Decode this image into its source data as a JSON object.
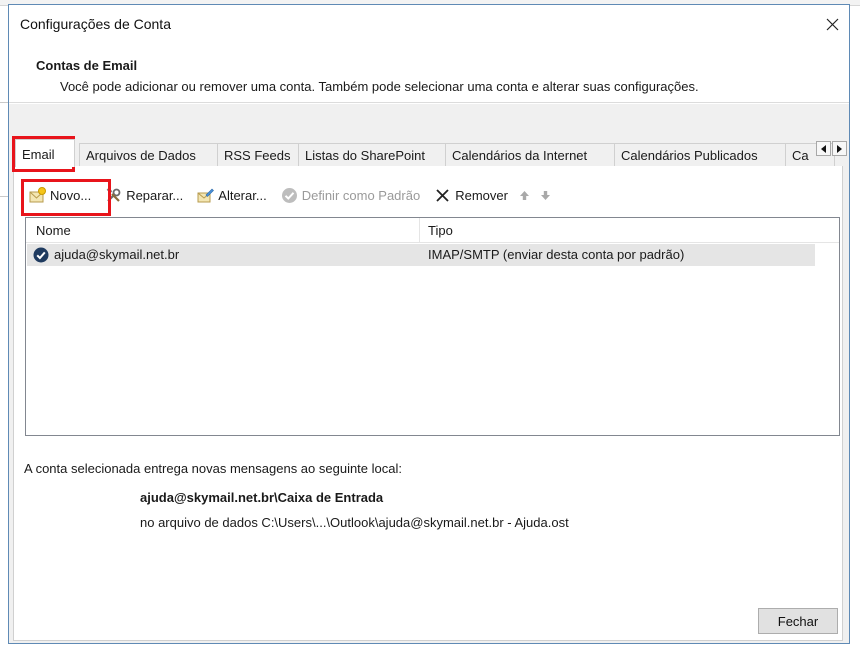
{
  "window": {
    "title": "Configurações de Conta"
  },
  "header": {
    "title": "Contas de Email",
    "description": "Você pode adicionar ou remover uma conta. Também pode selecionar uma conta e alterar suas configurações."
  },
  "tabs": [
    {
      "label": "Email",
      "active": true
    },
    {
      "label": "Arquivos de Dados"
    },
    {
      "label": "RSS Feeds"
    },
    {
      "label": "Listas do SharePoint"
    },
    {
      "label": "Calendários da Internet"
    },
    {
      "label": "Calendários Publicados"
    },
    {
      "label": "Ca"
    }
  ],
  "toolbar": {
    "new_label": "Novo...",
    "repair_label": "Reparar...",
    "change_label": "Alterar...",
    "set_default_label": "Definir como Padrão",
    "remove_label": "Remover"
  },
  "accounts": {
    "columns": [
      "Nome",
      "Tipo"
    ],
    "rows": [
      {
        "name": "ajuda@skymail.net.br",
        "type": "IMAP/SMTP (enviar desta conta por padrão)"
      }
    ]
  },
  "delivery": {
    "label": "A conta selecionada entrega novas mensagens ao seguinte local:",
    "path": "ajuda@skymail.net.br\\Caixa de Entrada",
    "file": "no arquivo de dados C:\\Users\\...\\Outlook\\ajuda@skymail.net.br - Ajuda.ost"
  },
  "buttons": {
    "close_label": "Fechar"
  },
  "colors": {
    "highlight": "#e8141b",
    "accent": "#1e4f8f"
  }
}
